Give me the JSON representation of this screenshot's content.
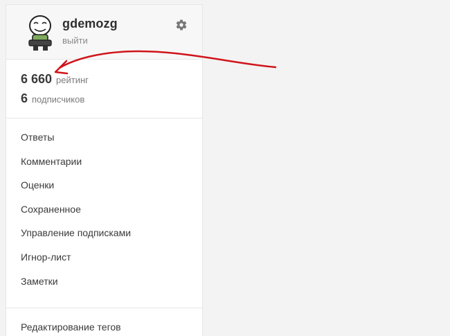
{
  "profile": {
    "username": "gdemozg",
    "logout_label": "выйти"
  },
  "stats": {
    "rating_value": "6 660",
    "rating_label": "рейтинг",
    "subscribers_value": "6",
    "subscribers_label": "подписчиков"
  },
  "menu": {
    "items": [
      {
        "label": "Ответы"
      },
      {
        "label": "Комментарии"
      },
      {
        "label": "Оценки"
      },
      {
        "label": "Сохраненное"
      },
      {
        "label": "Управление подписками"
      },
      {
        "label": "Игнор-лист"
      },
      {
        "label": "Заметки"
      }
    ]
  },
  "menu2": {
    "items": [
      {
        "label": "Редактирование тегов"
      }
    ]
  },
  "colors": {
    "annotation": "#d0141a",
    "background": "#f3f3f3"
  },
  "icons": {
    "settings": "gear-icon",
    "avatar": "avatar"
  }
}
